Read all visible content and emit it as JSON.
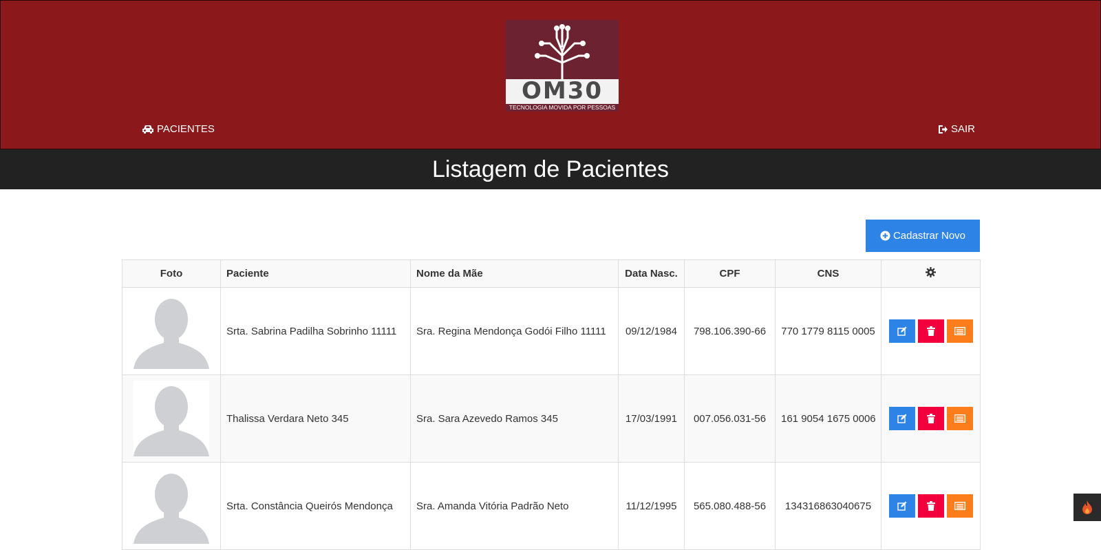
{
  "header": {
    "logo": {
      "text": "OM30",
      "tagline": "TECNOLOGIA MOVIDA POR PESSOAS"
    },
    "nav": {
      "pacientes": {
        "label": "PACIENTES",
        "icon": "car-icon"
      },
      "sair": {
        "label": "SAIR",
        "icon": "sign-out-icon"
      }
    },
    "colors": {
      "header_bg": "#8b181b",
      "title_bg": "#222222"
    }
  },
  "page": {
    "title": "Listagem de Pacientes"
  },
  "actions": {
    "new_button_label": "Cadastrar Novo",
    "new_button_icon": "plus-circle-icon",
    "accent": "#2d84e6"
  },
  "table": {
    "headers": {
      "foto": "Foto",
      "paciente": "Paciente",
      "mae": "Nome da Mãe",
      "nasc": "Data Nasc.",
      "cpf": "CPF",
      "cns": "CNS",
      "settings_icon": "gear-icon"
    },
    "rows": [
      {
        "paciente": "Srta. Sabrina Padilha Sobrinho 11111",
        "mae": "Sra. Regina Mendonça Godói Filho 11111",
        "nasc": "09/12/1984",
        "cpf": "798.106.390-66",
        "cns": "770 1779 8115 0005"
      },
      {
        "paciente": "Thalissa Verdara Neto 345",
        "mae": "Sra. Sara Azevedo Ramos 345",
        "nasc": "17/03/1991",
        "cpf": "007.056.031-56",
        "cns": "161 9054 1675 0006"
      },
      {
        "paciente": "Srta. Constância Queirós Mendonça",
        "mae": "Sra. Amanda Vitória Padrão Neto",
        "nasc": "11/12/1995",
        "cpf": "565.080.488-56",
        "cns": "134316863040675"
      }
    ],
    "row_actions": {
      "edit": {
        "icon": "edit-icon",
        "color": "#2d84e6"
      },
      "delete": {
        "icon": "trash-icon",
        "color": "#f2003e"
      },
      "details": {
        "icon": "list-icon",
        "color": "#fb7d1c"
      }
    }
  },
  "corner_widget": {
    "icon": "flame-icon"
  }
}
